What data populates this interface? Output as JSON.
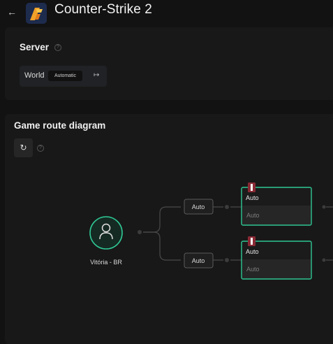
{
  "header": {
    "title": "Counter-Strike 2",
    "back_icon": "arrow-left-icon",
    "logo_icon": "counter-strike-logo"
  },
  "server": {
    "title": "Server",
    "help_icon": "question-circle-icon",
    "region": "World",
    "mode_badge": "Automatic",
    "action_icon": "exit-arrow-icon"
  },
  "route": {
    "title": "Game route diagram",
    "refresh_icon": "refresh-icon",
    "help_icon": "question-circle-icon",
    "origin": {
      "label": "Vitória - BR",
      "icon": "user-icon"
    },
    "paths": [
      {
        "selector": "Auto",
        "node_title": "Auto",
        "node_value": "Auto"
      },
      {
        "selector": "Auto",
        "node_title": "Auto",
        "node_value": "Auto"
      }
    ]
  },
  "colors": {
    "background": "#121212",
    "panel": "#181818",
    "accent": "#2fc894"
  }
}
